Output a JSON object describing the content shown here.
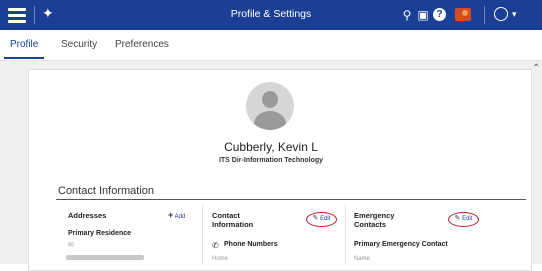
{
  "topbar": {
    "title": "Profile & Settings",
    "icons": [
      "menu-icon",
      "pin-icon",
      "search-icon",
      "camera-icon",
      "help-icon",
      "notification-icon",
      "user-icon",
      "chevron-down-icon"
    ],
    "help_glyph": "?",
    "color": "#1a3f95"
  },
  "tabs": [
    {
      "label": "Profile",
      "active": true
    },
    {
      "label": "Security",
      "active": false
    },
    {
      "label": "Preferences",
      "active": false
    }
  ],
  "profile": {
    "name": "Cubberly, Kevin L",
    "department": "ITS Dir-Information Technology"
  },
  "contact": {
    "section_title": "Contact Information",
    "addresses": {
      "title": "Addresses",
      "add_label": "Add",
      "primary_label": "Primary Residence"
    },
    "contact_info": {
      "title_line1": "Contact",
      "title_line2": "Information",
      "edit_label": "Edit",
      "phone_title": "Phone Numbers",
      "phone_sub": "Home"
    },
    "emergency": {
      "title_line1": "Emergency",
      "title_line2": "Contacts",
      "edit_label": "Edit",
      "primary_title": "Primary Emergency Contact",
      "name_label": "Name"
    }
  },
  "highlight_color": "#c0182a"
}
